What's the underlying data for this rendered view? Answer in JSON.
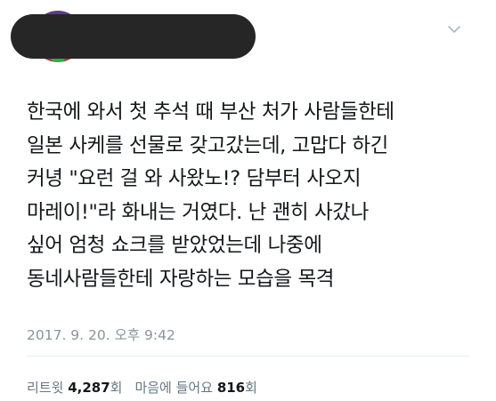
{
  "tweet": {
    "lines": [
      "한국에 와서 첫 추석 때 부산 처가 사람들한테",
      "일본 사케를 선물로 갖고갔는데, 고맙다 하긴",
      "커녕 \"요런 걸 와 사왔노!? 담부터 사오지",
      "마레이!\"라 화내는 거였다. 난 괜히 사갔나",
      "싶어 엄청 쇼크를 받았었는데 나중에",
      "동네사람들한테 자랑하는 모습을 목격"
    ],
    "timestamp": "2017. 9. 20. 오후 9:42"
  },
  "stats": {
    "retweets_label": "리트윗",
    "retweets_count": "4,287",
    "retweets_suffix": "회",
    "likes_label": "마음에 들어요",
    "likes_count": "816",
    "likes_suffix": "회"
  },
  "icons": {
    "menu": "chevron-down-icon"
  },
  "colors": {
    "text": "#14171a",
    "muted": "#8a949e",
    "redaction": "#262626"
  }
}
